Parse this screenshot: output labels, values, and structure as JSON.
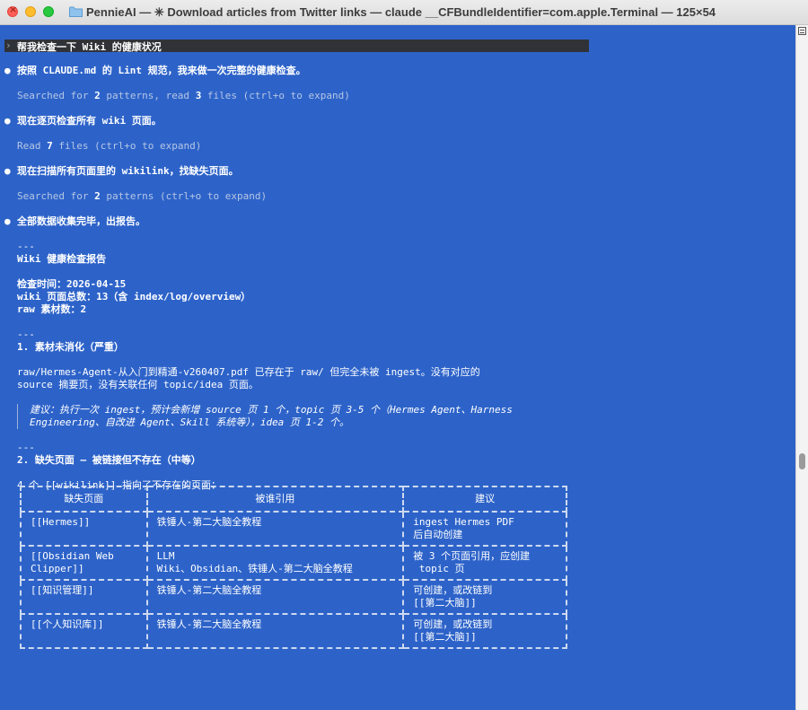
{
  "window": {
    "title": "PennieAI — ✳ Download articles from Twitter links — claude __CFBundleIdentifier=com.apple.Terminal — 125×54"
  },
  "colors": {
    "terminal_bg": "#2d63c9",
    "prompt_bg": "#2f3237"
  },
  "icons": [
    "close-icon",
    "minimize-icon",
    "maximize-icon",
    "folder-icon",
    "scrollbar-menu-icon"
  ],
  "terminal": {
    "prompt_marker": "›",
    "user_prompt": "帮我检查一下 Wiki 的健康状况",
    "bullet_glyph": "●",
    "msg1": "按照 CLAUDE.md 的 Lint 规范，我来做一次完整的健康检查。",
    "tool1": {
      "a": "Searched for ",
      "b": "2",
      "c": " patterns, read ",
      "d": "3",
      "e": " files (ctrl+o to expand)"
    },
    "msg2": "现在逐页检查所有 wiki 页面。",
    "tool2": {
      "a": "Read ",
      "b": "7",
      "c": " files (ctrl+o to expand)"
    },
    "msg3": "现在扫描所有页面里的 wikilink，找缺失页面。",
    "tool3": {
      "a": "Searched for ",
      "b": "2",
      "c": " patterns (ctrl+o to expand)"
    },
    "msg4": "全部数据收集完毕，出报告。",
    "rule": "---",
    "report_title": "Wiki 健康检查报告",
    "check_time": "检查时间：2026-04-15",
    "page_total": "wiki 页面总数：13（含 index/log/overview）",
    "raw_count": "raw 素材数：2",
    "section1": "1. 素材未消化（严重）",
    "s1_line1": "raw/Hermes-Agent-从入门到精通-v260407.pdf 已存在于 raw/ 但完全未被 ingest。没有对应的",
    "s1_line2": "source 摘要页，没有关联任何 topic/idea 页面。",
    "s1_quote1": "建议：执行一次 ingest，预计会新增 source 页 1 个，topic 页 3-5 个（Hermes Agent、Harness",
    "s1_quote2": "Engineering、自改进 Agent、Skill 系统等），idea 页 1-2 个。",
    "section2": "2. 缺失页面 — 被链接但不存在（中等）",
    "s2_intro": "4 个 [[wikilink]] 指向了不存在的页面：",
    "table": {
      "headers": [
        "缺失页面",
        "被谁引用",
        "建议"
      ],
      "rows": [
        [
          "[[Hermes]]",
          "铁锤人-第二大脑全教程",
          "ingest Hermes PDF\n后自动创建"
        ],
        [
          "[[Obsidian Web\nClipper]]",
          "LLM\nWiki、Obsidian、铁锤人-第二大脑全教程",
          "被 3 个页面引用，应创建\n topic 页"
        ],
        [
          "[[知识管理]]",
          "铁锤人-第二大脑全教程",
          "可创建，或改链到\n[[第二大脑]]"
        ],
        [
          "[[个人知识库]]",
          "铁锤人-第二大脑全教程",
          "可创建，或改链到\n[[第二大脑]]"
        ]
      ]
    }
  }
}
